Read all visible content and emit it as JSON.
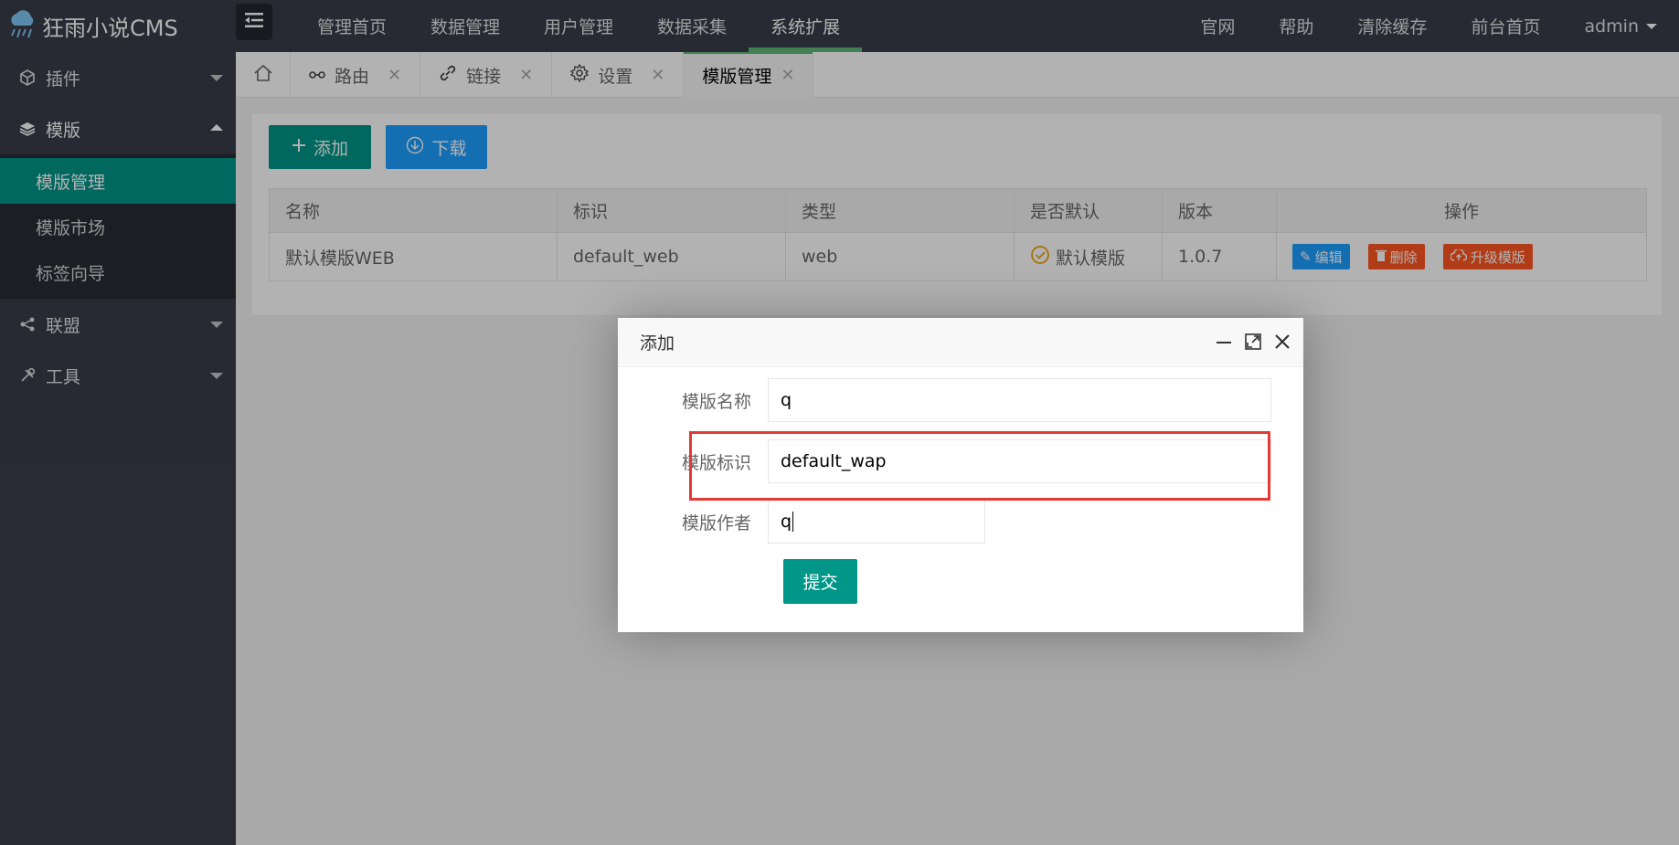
{
  "app": {
    "title": "狂雨小说CMS"
  },
  "top_nav": [
    {
      "label": "管理首页",
      "active": false
    },
    {
      "label": "数据管理",
      "active": false
    },
    {
      "label": "用户管理",
      "active": false
    },
    {
      "label": "数据采集",
      "active": false
    },
    {
      "label": "系统扩展",
      "active": true
    }
  ],
  "top_right": {
    "website": "官网",
    "help": "帮助",
    "clear_cache": "清除缓存",
    "frontend": "前台首页",
    "user": "admin"
  },
  "sidebar": {
    "groups": [
      {
        "label": "插件",
        "icon": "cube-icon"
      },
      {
        "label": "模版",
        "icon": "layers-icon",
        "open": true
      },
      {
        "label": "联盟",
        "icon": "share-icon"
      },
      {
        "label": "工具",
        "icon": "tools-icon"
      }
    ],
    "sub_items": [
      {
        "label": "模版管理",
        "active": true
      },
      {
        "label": "模版市场"
      },
      {
        "label": "标签向导"
      }
    ]
  },
  "tabs": [
    {
      "label": "路由",
      "icon": "route-icon"
    },
    {
      "label": "链接",
      "icon": "link-icon"
    },
    {
      "label": "设置",
      "icon": "gear-icon"
    },
    {
      "label": "模版管理",
      "active": true
    }
  ],
  "toolbar": {
    "add_label": "添加",
    "download_label": "下载"
  },
  "table": {
    "columns": [
      "名称",
      "标识",
      "类型",
      "是否默认",
      "版本",
      "操作"
    ],
    "rows": [
      {
        "name": "默认模版WEB",
        "id": "default_web",
        "type": "web",
        "default": "默认模版",
        "version": "1.0.7",
        "actions": {
          "edit": "编辑",
          "delete": "删除",
          "upgrade": "升级模版"
        }
      }
    ]
  },
  "dialog": {
    "title": "添加",
    "fields": {
      "name_label": "模版名称",
      "name_value": "q",
      "id_label": "模版标识",
      "id_value": "default_wap",
      "author_label": "模版作者",
      "author_value": "q"
    },
    "submit_label": "提交"
  },
  "colors": {
    "header_bg": "#393d49",
    "accent_green": "#009688",
    "accent_blue": "#1e9fff",
    "accent_red": "#ff5722",
    "highlight_red": "#e53935"
  }
}
